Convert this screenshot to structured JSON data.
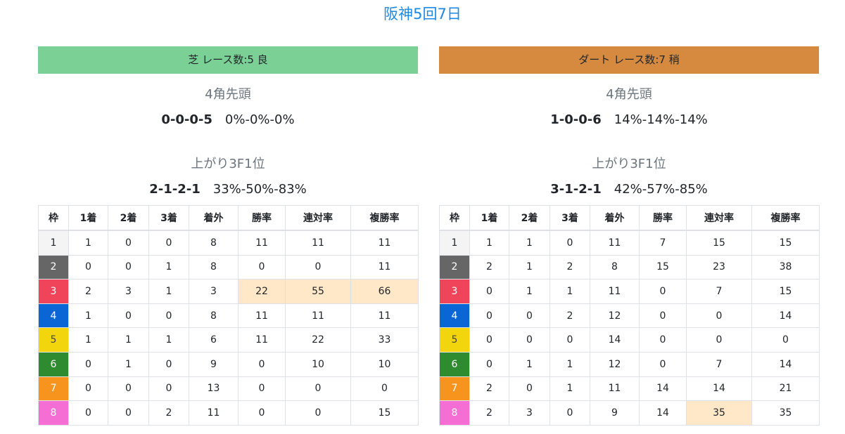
{
  "page_title": "阪神5回7日",
  "colors": {
    "title": "#1e88e5",
    "turf_banner": "#7ad095",
    "dirt_banner": "#d58a40",
    "highlight": "#ffe8c8",
    "waku": [
      "#f4f4f4",
      "#666666",
      "#f0445a",
      "#0a66d4",
      "#f2d50c",
      "#2f8b2f",
      "#f7941d",
      "#f46ed4"
    ]
  },
  "columns": [
    "枠",
    "1着",
    "2着",
    "3着",
    "着外",
    "勝率",
    "連対率",
    "複勝率"
  ],
  "turf": {
    "banner": "芝 レース数:5 良",
    "front_label": "4角先頭",
    "front_record": "0-0-0-5",
    "front_pct": "0%-0%-0%",
    "agari_label": "上がり3F1位",
    "agari_record": "2-1-2-1",
    "agari_pct": "33%-50%-83%",
    "rows": [
      [
        1,
        1,
        0,
        0,
        8,
        11,
        11,
        11
      ],
      [
        2,
        0,
        0,
        1,
        8,
        0,
        0,
        11
      ],
      [
        3,
        2,
        3,
        1,
        3,
        22,
        55,
        66
      ],
      [
        4,
        1,
        0,
        0,
        8,
        11,
        11,
        11
      ],
      [
        5,
        1,
        1,
        1,
        6,
        11,
        22,
        33
      ],
      [
        6,
        0,
        1,
        0,
        9,
        0,
        10,
        10
      ],
      [
        7,
        0,
        0,
        0,
        13,
        0,
        0,
        0
      ],
      [
        8,
        0,
        0,
        2,
        11,
        0,
        0,
        15
      ]
    ],
    "highlights": [
      [
        2,
        5
      ],
      [
        2,
        6
      ],
      [
        2,
        7
      ]
    ]
  },
  "dirt": {
    "banner": "ダート レース数:7 稍",
    "front_label": "4角先頭",
    "front_record": "1-0-0-6",
    "front_pct": "14%-14%-14%",
    "agari_label": "上がり3F1位",
    "agari_record": "3-1-2-1",
    "agari_pct": "42%-57%-85%",
    "rows": [
      [
        1,
        1,
        1,
        0,
        11,
        7,
        15,
        15
      ],
      [
        2,
        2,
        1,
        2,
        8,
        15,
        23,
        38
      ],
      [
        3,
        0,
        1,
        1,
        11,
        0,
        7,
        15
      ],
      [
        4,
        0,
        0,
        2,
        12,
        0,
        0,
        14
      ],
      [
        5,
        0,
        0,
        0,
        14,
        0,
        0,
        0
      ],
      [
        6,
        0,
        1,
        1,
        12,
        0,
        7,
        14
      ],
      [
        7,
        2,
        0,
        1,
        11,
        14,
        14,
        21
      ],
      [
        8,
        2,
        3,
        0,
        9,
        14,
        35,
        35
      ]
    ],
    "highlights": [
      [
        7,
        6
      ]
    ]
  }
}
